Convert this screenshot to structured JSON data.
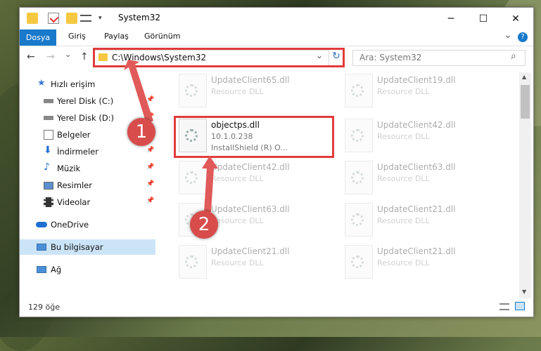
{
  "window": {
    "title": "System32",
    "minimize": "─",
    "maximize": "☐",
    "close": "✕"
  },
  "ribbon": {
    "tabs": [
      "Dosya",
      "Giriş",
      "Paylaş",
      "Görünüm"
    ],
    "expand": "⌄",
    "help": "?"
  },
  "nav": {
    "back": "←",
    "forward": "→",
    "recent": "⌄",
    "up": "↑",
    "address": "C:\\Windows\\System32",
    "address_dropdown": "⌄",
    "refresh": "↻",
    "search_placeholder": "Ara: System32",
    "search_icon": "⌕"
  },
  "sidebar": {
    "items": [
      {
        "label": "Hızlı erişim",
        "icon": "star-icon"
      },
      {
        "label": "Yerel Disk (C:)",
        "icon": "drive-icon",
        "pinned": true
      },
      {
        "label": "Yerel Disk (D:)",
        "icon": "drive-icon",
        "pinned": true
      },
      {
        "label": "Belgeler",
        "icon": "documents-icon",
        "pinned": true
      },
      {
        "label": "İndirmeler",
        "icon": "download-icon",
        "pinned": true
      },
      {
        "label": "Müzik",
        "icon": "music-icon",
        "pinned": true
      },
      {
        "label": "Resimler",
        "icon": "pictures-icon",
        "pinned": true
      },
      {
        "label": "Videolar",
        "icon": "videos-icon",
        "pinned": true
      },
      {
        "label": "OneDrive",
        "icon": "cloud-icon"
      },
      {
        "label": "Bu bilgisayar",
        "icon": "computer-icon",
        "selected": true
      },
      {
        "label": "Ağ",
        "icon": "network-icon"
      }
    ]
  },
  "files": [
    {
      "name": "UpdateClient65.dll",
      "type": "Resource DLL",
      "faded": true
    },
    {
      "name": "UpdateClient19.dll",
      "type": "Resource DLL",
      "faded": true
    },
    {
      "name": "objectps.dll",
      "type": "10.1.0.238",
      "sub": "InstallShield (R) O...",
      "faded": false
    },
    {
      "name": "UpdateClient42.dll",
      "type": "Resource DLL",
      "faded": true
    },
    {
      "name": "UpdateClient42.dll",
      "type": "Resource DLL",
      "faded": true
    },
    {
      "name": "UpdateClient63.dll",
      "type": "Resource DLL",
      "faded": true
    },
    {
      "name": "UpdateClient63.dll",
      "type": "Resource DLL",
      "faded": true
    },
    {
      "name": "UpdateClient21.dll",
      "type": "Resource DLL",
      "faded": true
    },
    {
      "name": "UpdateClient21.dll",
      "type": "Resource DLL",
      "faded": true
    },
    {
      "name": "UpdateClient21.dll",
      "type": "Resource DLL",
      "faded": true
    }
  ],
  "status": {
    "count": "129 öğe"
  },
  "annotations": {
    "badge1": "1",
    "badge2": "2",
    "color": "#e03c3c"
  }
}
